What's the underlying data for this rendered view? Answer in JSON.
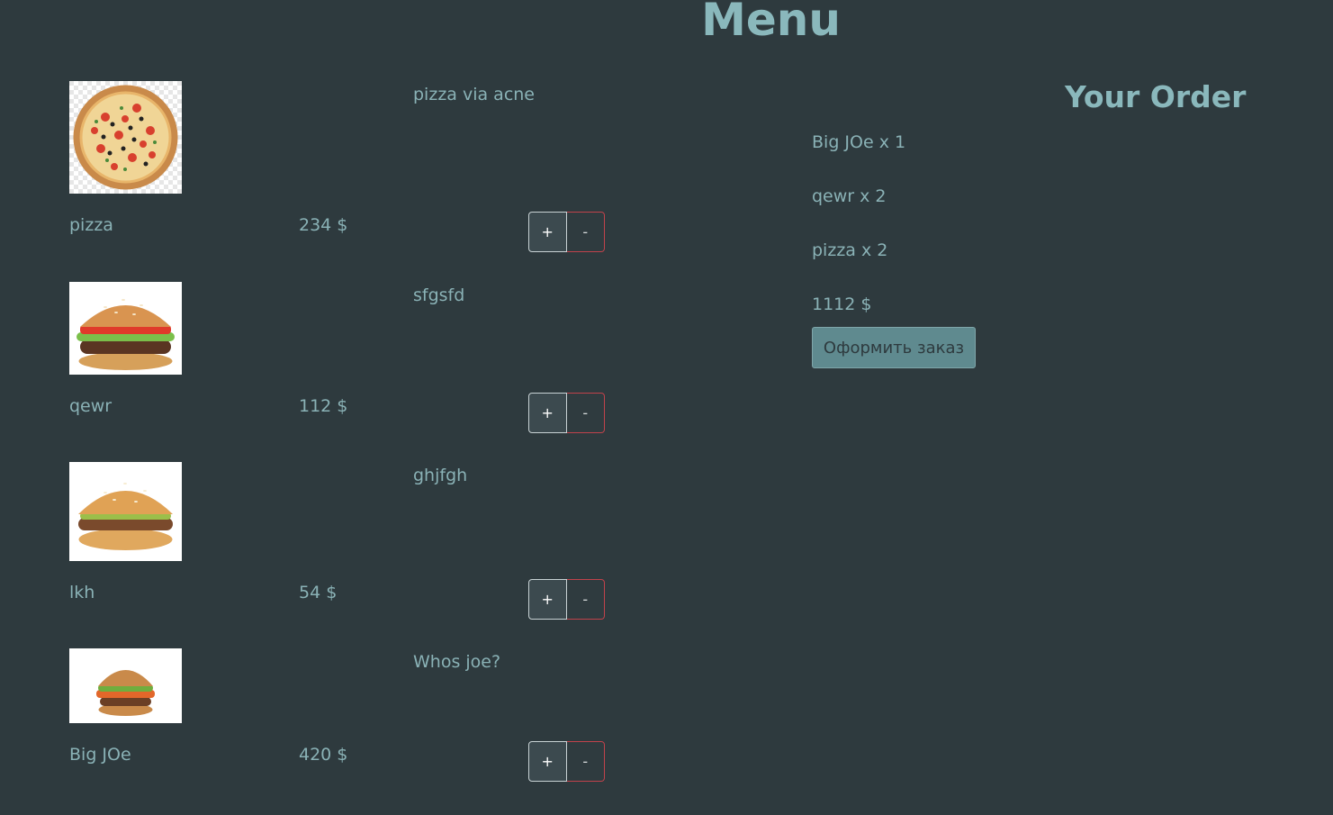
{
  "header": {
    "title": "Menu"
  },
  "menu": {
    "items": [
      {
        "name": "pizza",
        "price": "234 $",
        "description": "pizza via acne",
        "plus_label": "+",
        "minus_label": "-",
        "image": "pizza-image"
      },
      {
        "name": "qewr",
        "price": "112 $",
        "description": "sfgsfd",
        "plus_label": "+",
        "minus_label": "-",
        "image": "burger-image"
      },
      {
        "name": "lkh",
        "price": "54 $",
        "description": "ghjfgh",
        "plus_label": "+",
        "minus_label": "-",
        "image": "burger-image"
      },
      {
        "name": "Big JOe",
        "price": "420 $",
        "description": "Whos joe?",
        "plus_label": "+",
        "minus_label": "-",
        "image": "burger-image"
      }
    ]
  },
  "order": {
    "title": "Your Order",
    "lines": [
      "Big JOe x 1",
      "qewr x 2",
      "pizza x 2"
    ],
    "total": "1112 $",
    "checkout_label": "Оформить заказ"
  },
  "colors": {
    "background": "#2e3a3e",
    "text": "#8ab2b6",
    "checkout_button": "#5f8a8f",
    "minus_border": "#c0424b"
  }
}
